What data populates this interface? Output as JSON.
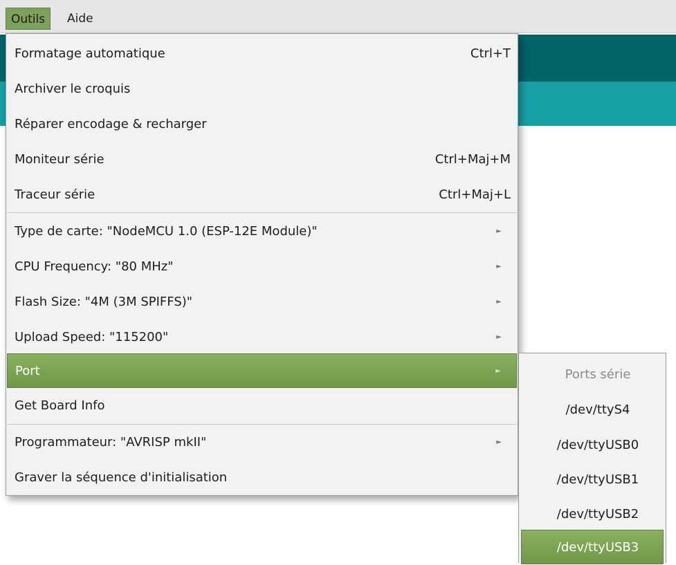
{
  "menubar": {
    "items": [
      {
        "label": "Outils",
        "active": true
      },
      {
        "label": "Aide",
        "active": false
      }
    ]
  },
  "menu": {
    "items": [
      {
        "label": "Formatage automatique",
        "shortcut": "Ctrl+T"
      },
      {
        "label": "Archiver le croquis",
        "shortcut": ""
      },
      {
        "label": "Réparer encodage & recharger",
        "shortcut": ""
      },
      {
        "label": "Moniteur série",
        "shortcut": "Ctrl+Maj+M"
      },
      {
        "label": "Traceur série",
        "shortcut": "Ctrl+Maj+L"
      },
      {
        "label": "Type de carte: \"NodeMCU 1.0 (ESP-12E Module)\"",
        "submenu": true
      },
      {
        "label": "CPU Frequency: \"80 MHz\"",
        "submenu": true
      },
      {
        "label": "Flash Size: \"4M (3M SPIFFS)\"",
        "submenu": true
      },
      {
        "label": "Upload Speed: \"115200\"",
        "submenu": true
      },
      {
        "label": "Port",
        "submenu": true,
        "highlighted": true
      },
      {
        "label": "Get Board Info"
      },
      {
        "label": "Programmateur: \"AVRISP mkII\"",
        "submenu": true
      },
      {
        "label": "Graver la séquence d'initialisation"
      }
    ],
    "submenu_arrow": "►"
  },
  "port_submenu": {
    "header": "Ports série",
    "items": [
      {
        "label": "/dev/ttyS4"
      },
      {
        "label": "/dev/ttyUSB0"
      },
      {
        "label": "/dev/ttyUSB1"
      },
      {
        "label": "/dev/ttyUSB2"
      },
      {
        "label": "/dev/ttyUSB3",
        "highlighted": true
      }
    ]
  },
  "colors": {
    "highlight": "#7ea15b",
    "app_dark": "#006468",
    "app_teal": "#17a1a5",
    "menu_bg": "#f2f2f2"
  }
}
